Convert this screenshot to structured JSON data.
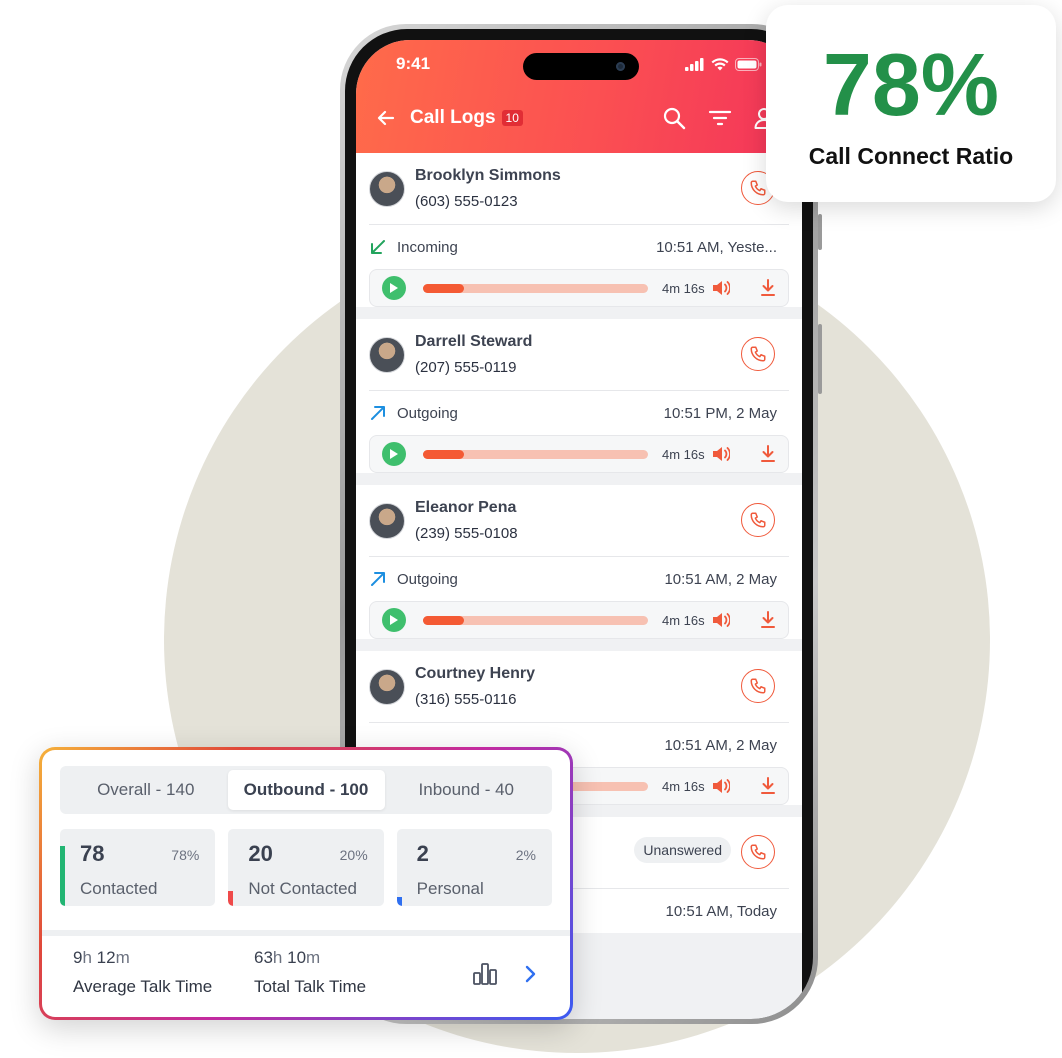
{
  "status_bar": {
    "time": "9:41"
  },
  "header": {
    "title": "Call Logs",
    "badge": "10"
  },
  "call_logs": [
    {
      "name": "Brooklyn Simmons",
      "phone": "(603) 555-0123",
      "direction": "Incoming",
      "when": "10:51 AM, Yeste...",
      "duration": "4m 16s",
      "progress": 0.18
    },
    {
      "name": "Darrell Steward",
      "phone": "(207) 555-0119",
      "direction": "Outgoing",
      "when": "10:51 PM, 2 May",
      "duration": "4m 16s",
      "progress": 0.18
    },
    {
      "name": "Eleanor Pena",
      "phone": "(239) 555-0108",
      "direction": "Outgoing",
      "when": "10:51 AM, 2 May",
      "duration": "4m 16s",
      "progress": 0.18
    },
    {
      "name": "Courtney Henry",
      "phone": "(316) 555-0116",
      "direction": "",
      "when": "10:51 AM, 2 May",
      "duration": "4m 16s",
      "progress": 0.18
    },
    {
      "name": "",
      "phone": "",
      "status": "Unanswered",
      "when": "10:51 AM, Today"
    }
  ],
  "ratio_card": {
    "value": "78%",
    "label": "Call Connect Ratio"
  },
  "stats": {
    "tabs": [
      "Overall - 140",
      "Outbound - 100",
      "Inbound - 40"
    ],
    "active_tab": "Outbound - 100",
    "tiles": [
      {
        "count": "78",
        "percent": "78%",
        "label": "Contacted",
        "color": "#22b573",
        "level": 0.78
      },
      {
        "count": "20",
        "percent": "20%",
        "label": "Not Contacted",
        "color": "#ef4a4a",
        "level": 0.2
      },
      {
        "count": "2",
        "percent": "2%",
        "label": "Personal",
        "color": "#2f6ff0",
        "level": 0.02
      }
    ],
    "average_talk": {
      "h": "9",
      "h_unit": "h",
      "m": "12",
      "m_unit": "m",
      "label": "Average Talk Time"
    },
    "total_talk": {
      "h": "63",
      "h_unit": "h",
      "m": "10",
      "m_unit": "m",
      "label": "Total Talk Time"
    }
  },
  "colors": {
    "accent": "#f05a3c",
    "ratio_green": "#239049",
    "play_green": "#3fbf6d"
  }
}
